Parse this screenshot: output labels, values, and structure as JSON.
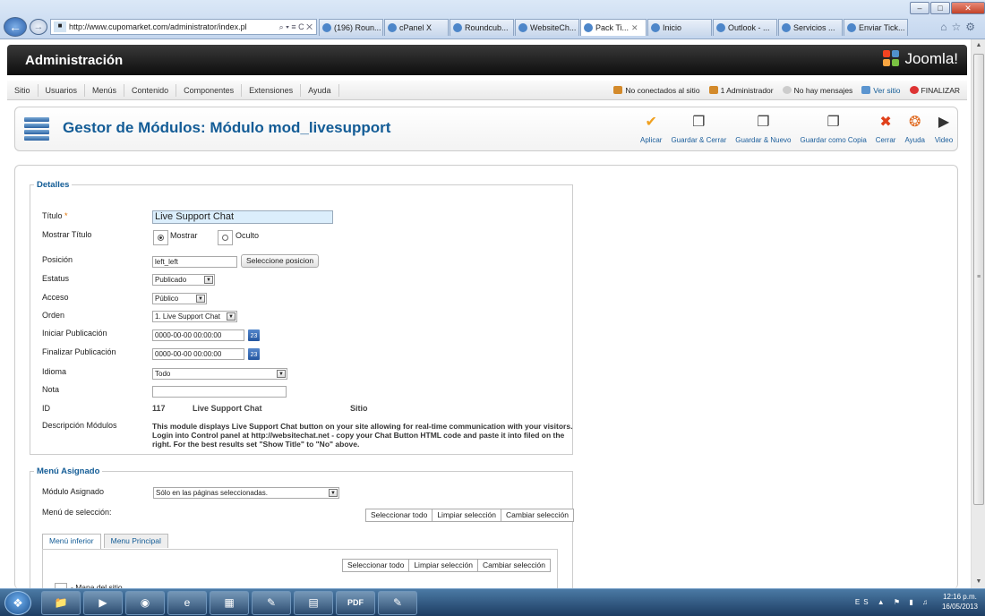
{
  "browser": {
    "url": "http://www.cupomarket.com/administrator/index.pl",
    "address_tools": "⌕ ▾ ≡ C ✕",
    "tabs": [
      {
        "label": "(196) Roun...",
        "active": false
      },
      {
        "label": "cPanel X",
        "active": false
      },
      {
        "label": "Roundcub...",
        "active": false
      },
      {
        "label": "WebsiteCh...",
        "active": false
      },
      {
        "label": "Pack Ti...",
        "active": true
      },
      {
        "label": "Inicio",
        "active": false
      },
      {
        "label": "Outlook - ...",
        "active": false
      },
      {
        "label": "Servicios ...",
        "active": false
      },
      {
        "label": "Enviar Tick...",
        "active": false
      }
    ]
  },
  "header": {
    "title": "Administración",
    "logo_text": "Joomla!"
  },
  "menu": {
    "items": [
      "Sitio",
      "Usuarios",
      "Menús",
      "Contenido",
      "Componentes",
      "Extensiones",
      "Ayuda"
    ],
    "status": {
      "visitors": "No conectados al sitio",
      "admins": "1 Administrador",
      "messages": "No hay mensajes",
      "view_site": "Ver sitio",
      "logout": "FINALIZAR"
    }
  },
  "toolbar": {
    "page_title": "Gestor de Módulos: Módulo mod_livesupport",
    "buttons": [
      {
        "label": "Aplicar",
        "icon": "check-icon"
      },
      {
        "label": "Guardar & Cerrar",
        "icon": "save-close-icon"
      },
      {
        "label": "Guardar & Nuevo",
        "icon": "save-new-icon"
      },
      {
        "label": "Guardar como Copia",
        "icon": "save-copy-icon"
      },
      {
        "label": "Cerrar",
        "icon": "close-icon"
      },
      {
        "label": "Ayuda",
        "icon": "help-icon"
      },
      {
        "label": "Video",
        "icon": "video-icon"
      }
    ]
  },
  "details": {
    "legend": "Detalles",
    "title_label": "Título",
    "title_required": "*",
    "title_value": "Live Support Chat",
    "show_title_label": "Mostrar Título",
    "show_option": "Mostrar",
    "hide_option": "Oculto",
    "position_label": "Posición",
    "position_value": "left_left",
    "position_button": "Seleccione posicion",
    "status_label": "Estatus",
    "status_value": "Publicado",
    "access_label": "Acceso",
    "access_value": "Público",
    "order_label": "Orden",
    "order_value": "1. Live Support Chat",
    "start_label": "Iniciar Publicación",
    "start_value": "0000-00-00 00:00:00",
    "end_label": "Finalizar Publicación",
    "end_value": "0000-00-00 00:00:00",
    "calendar_day": "23",
    "language_label": "Idioma",
    "language_value": "Todo",
    "note_label": "Nota",
    "note_value": "",
    "id_label": "ID",
    "id_value": "117",
    "id_module_name": "Live Support Chat",
    "id_client": "Sitio",
    "description_label": "Descripción Módulos",
    "description_text": "This module displays Live Support Chat button on your site allowing for real-time communication with your visitors. Login into Control panel at http://websitechat.net - copy your Chat Button HTML code and paste it into filed on the right. For the best results set \"Show Title\" to \"No\" above."
  },
  "menu_assignment": {
    "legend": "Menú Asignado",
    "assigned_label": "Módulo Asignado",
    "assigned_value": "Sólo en las páginas seleccionadas.",
    "selection_label": "Menú de selección:",
    "buttons": [
      "Seleccionar todo",
      "Limpiar selección",
      "Cambiar selección"
    ],
    "tabs": [
      "Menú inferior",
      "Menu Principal"
    ],
    "first_item": "- Mapa del sitio"
  },
  "taskbar": {
    "lang": "ES",
    "time": "12:16 p.m.",
    "date": "16/05/2013"
  }
}
